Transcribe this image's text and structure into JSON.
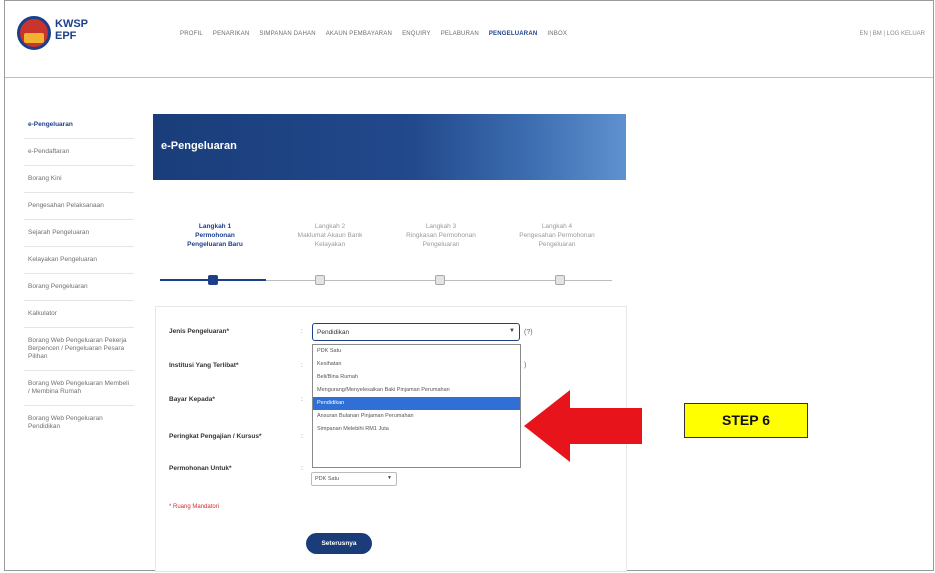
{
  "header": {
    "logo_line1": "KWSP",
    "logo_line2": "EPF",
    "nav": [
      "PROFIL",
      "PENARIKAN",
      "SIMPANAN DAHAN",
      "AKAUN PEMBAYARAN",
      "ENQUIRY",
      "PELABURAN",
      "PENGELUARAN",
      "INBOX"
    ],
    "nav_active_index": 6,
    "lang": "EN | BM | LOG KELUAR"
  },
  "sidebar": {
    "items": [
      "e-Pengeluaran",
      "e-Pendaftaran",
      "Borang Kini",
      "Pengesahan Pelaksanaan",
      "Sejarah Pengeluaran",
      "Kelayakan Pengeluaran",
      "Borang Pengeluaran",
      "Kalkulator",
      "Borang Web Pengeluaran Pekerja Berpencen / Pengeluaran Pesara Pilihan",
      "Borang Web Pengeluaran Membeli / Membina Rumah",
      "Borang Web Pengeluaran Pendidikan"
    ],
    "active_index": 0
  },
  "banner": {
    "title": "e-Pengeluaran"
  },
  "steps": [
    {
      "label": "Langkah 1\nPermohonan\nPengeluaran Baru",
      "active": true
    },
    {
      "label": "Langkah 2\nMaklumat Akaun Bank\nKelayakan",
      "active": false
    },
    {
      "label": "Langkah 3\nRingkasan Permohonan\nPengeluaran",
      "active": false
    },
    {
      "label": "Langkah 4\nPengesahan Permohonan\nPengeluaran",
      "active": false
    }
  ],
  "form": {
    "labels": {
      "jenis": "Jenis Pengeluaran*",
      "institusi": "Institusi Yang Terlibat*",
      "bayar": "Bayar Kepada*",
      "peringkat": "Peringkat Pengajian / Kursus*",
      "permohonan": "Permohonan Untuk*"
    },
    "colon": ":",
    "jenis_value": "Pendidikan",
    "help": "(?)",
    "options": [
      "PDK Satu",
      "Kesihatan",
      "Beli/Bina Rumah",
      "Mengurang/Menyelesaikan Baki Pinjaman Perumahan",
      "Pendidikan",
      "Ansuran Bulanan Pinjaman Perumahan",
      "Simpanan Melebihi RM1 Juta"
    ],
    "selected_option_index": 4,
    "permohonan_value": "PDK Satu",
    "mandatory_note": "* Ruang Mandatori",
    "next_button": "Seterusnya"
  },
  "annotation": {
    "label": "STEP 6",
    "arrow_color": "#e8141b",
    "box_color": "#ffff00"
  }
}
